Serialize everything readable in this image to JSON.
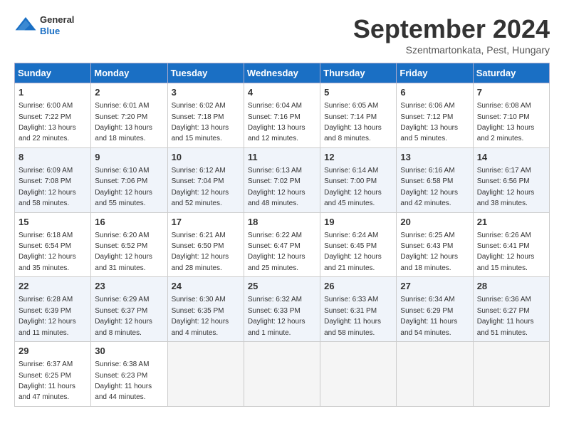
{
  "header": {
    "logo": {
      "general": "General",
      "blue": "Blue"
    },
    "title": "September 2024",
    "subtitle": "Szentmartonkata, Pest, Hungary"
  },
  "calendar": {
    "days_of_week": [
      "Sunday",
      "Monday",
      "Tuesday",
      "Wednesday",
      "Thursday",
      "Friday",
      "Saturday"
    ],
    "weeks": [
      [
        {
          "day": 1,
          "sunrise": "6:00 AM",
          "sunset": "7:22 PM",
          "daylight": "13 hours and 22 minutes."
        },
        {
          "day": 2,
          "sunrise": "6:01 AM",
          "sunset": "7:20 PM",
          "daylight": "13 hours and 18 minutes."
        },
        {
          "day": 3,
          "sunrise": "6:02 AM",
          "sunset": "7:18 PM",
          "daylight": "13 hours and 15 minutes."
        },
        {
          "day": 4,
          "sunrise": "6:04 AM",
          "sunset": "7:16 PM",
          "daylight": "13 hours and 12 minutes."
        },
        {
          "day": 5,
          "sunrise": "6:05 AM",
          "sunset": "7:14 PM",
          "daylight": "13 hours and 8 minutes."
        },
        {
          "day": 6,
          "sunrise": "6:06 AM",
          "sunset": "7:12 PM",
          "daylight": "13 hours and 5 minutes."
        },
        {
          "day": 7,
          "sunrise": "6:08 AM",
          "sunset": "7:10 PM",
          "daylight": "13 hours and 2 minutes."
        }
      ],
      [
        {
          "day": 8,
          "sunrise": "6:09 AM",
          "sunset": "7:08 PM",
          "daylight": "12 hours and 58 minutes."
        },
        {
          "day": 9,
          "sunrise": "6:10 AM",
          "sunset": "7:06 PM",
          "daylight": "12 hours and 55 minutes."
        },
        {
          "day": 10,
          "sunrise": "6:12 AM",
          "sunset": "7:04 PM",
          "daylight": "12 hours and 52 minutes."
        },
        {
          "day": 11,
          "sunrise": "6:13 AM",
          "sunset": "7:02 PM",
          "daylight": "12 hours and 48 minutes."
        },
        {
          "day": 12,
          "sunrise": "6:14 AM",
          "sunset": "7:00 PM",
          "daylight": "12 hours and 45 minutes."
        },
        {
          "day": 13,
          "sunrise": "6:16 AM",
          "sunset": "6:58 PM",
          "daylight": "12 hours and 42 minutes."
        },
        {
          "day": 14,
          "sunrise": "6:17 AM",
          "sunset": "6:56 PM",
          "daylight": "12 hours and 38 minutes."
        }
      ],
      [
        {
          "day": 15,
          "sunrise": "6:18 AM",
          "sunset": "6:54 PM",
          "daylight": "12 hours and 35 minutes."
        },
        {
          "day": 16,
          "sunrise": "6:20 AM",
          "sunset": "6:52 PM",
          "daylight": "12 hours and 31 minutes."
        },
        {
          "day": 17,
          "sunrise": "6:21 AM",
          "sunset": "6:50 PM",
          "daylight": "12 hours and 28 minutes."
        },
        {
          "day": 18,
          "sunrise": "6:22 AM",
          "sunset": "6:47 PM",
          "daylight": "12 hours and 25 minutes."
        },
        {
          "day": 19,
          "sunrise": "6:24 AM",
          "sunset": "6:45 PM",
          "daylight": "12 hours and 21 minutes."
        },
        {
          "day": 20,
          "sunrise": "6:25 AM",
          "sunset": "6:43 PM",
          "daylight": "12 hours and 18 minutes."
        },
        {
          "day": 21,
          "sunrise": "6:26 AM",
          "sunset": "6:41 PM",
          "daylight": "12 hours and 15 minutes."
        }
      ],
      [
        {
          "day": 22,
          "sunrise": "6:28 AM",
          "sunset": "6:39 PM",
          "daylight": "12 hours and 11 minutes."
        },
        {
          "day": 23,
          "sunrise": "6:29 AM",
          "sunset": "6:37 PM",
          "daylight": "12 hours and 8 minutes."
        },
        {
          "day": 24,
          "sunrise": "6:30 AM",
          "sunset": "6:35 PM",
          "daylight": "12 hours and 4 minutes."
        },
        {
          "day": 25,
          "sunrise": "6:32 AM",
          "sunset": "6:33 PM",
          "daylight": "12 hours and 1 minute."
        },
        {
          "day": 26,
          "sunrise": "6:33 AM",
          "sunset": "6:31 PM",
          "daylight": "11 hours and 58 minutes."
        },
        {
          "day": 27,
          "sunrise": "6:34 AM",
          "sunset": "6:29 PM",
          "daylight": "11 hours and 54 minutes."
        },
        {
          "day": 28,
          "sunrise": "6:36 AM",
          "sunset": "6:27 PM",
          "daylight": "11 hours and 51 minutes."
        }
      ],
      [
        {
          "day": 29,
          "sunrise": "6:37 AM",
          "sunset": "6:25 PM",
          "daylight": "11 hours and 47 minutes."
        },
        {
          "day": 30,
          "sunrise": "6:38 AM",
          "sunset": "6:23 PM",
          "daylight": "11 hours and 44 minutes."
        },
        null,
        null,
        null,
        null,
        null
      ]
    ]
  }
}
